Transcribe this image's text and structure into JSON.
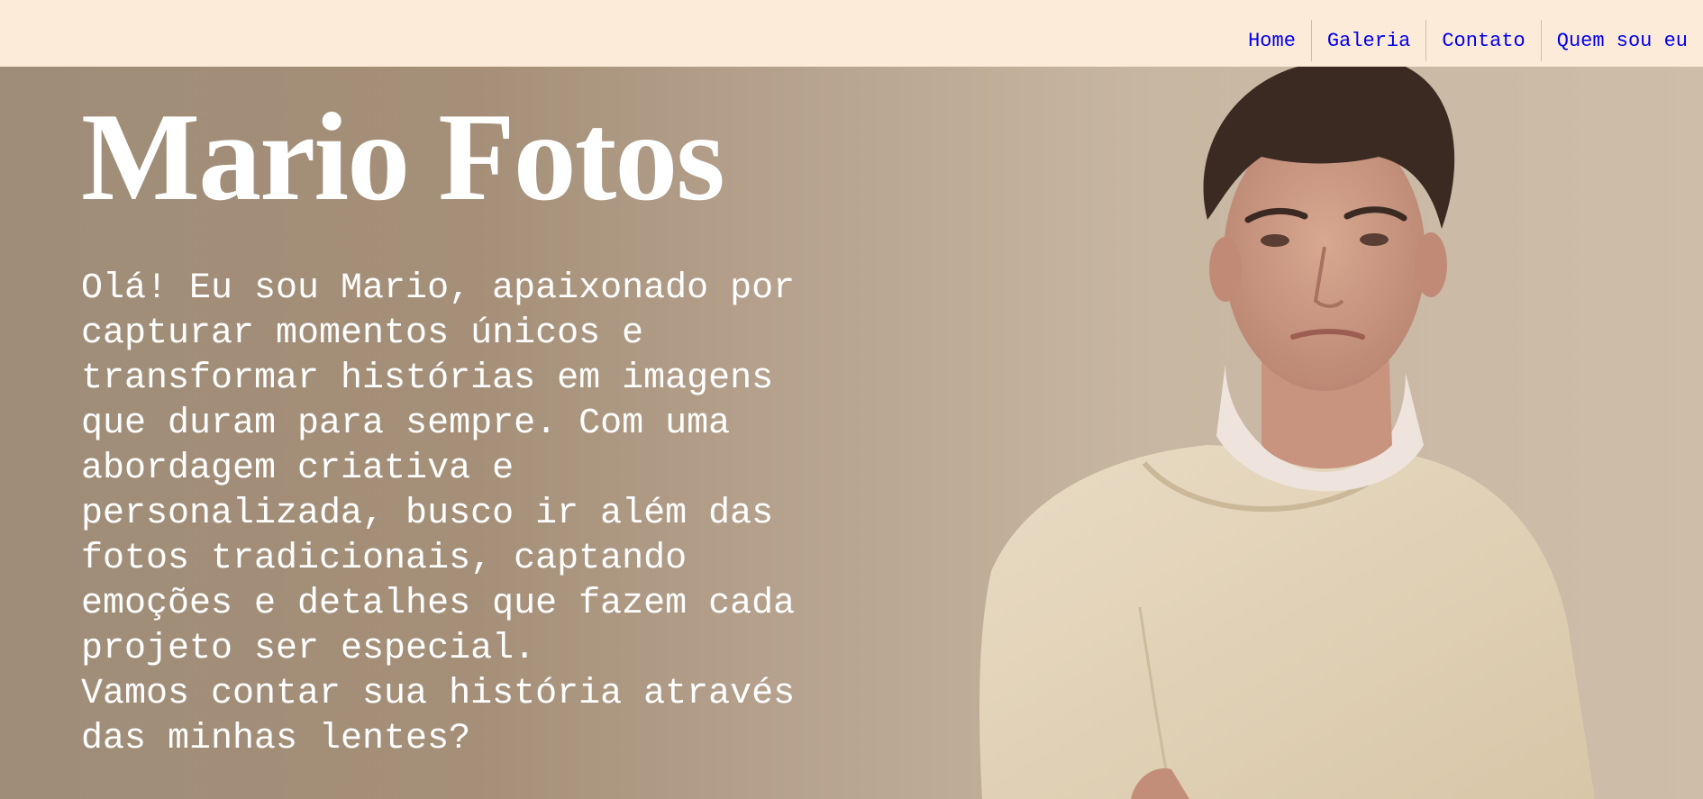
{
  "nav": {
    "items": [
      {
        "label": "Home"
      },
      {
        "label": "Galeria"
      },
      {
        "label": "Contato"
      },
      {
        "label": "Quem sou eu"
      }
    ]
  },
  "hero": {
    "title": "Mario Fotos",
    "paragraph": "Olá! Eu sou Mario, apaixonado por\ncapturar momentos únicos e\ntransformar histórias em imagens\nque duram para sempre. Com uma\nabordagem criativa e\npersonalizada, busco ir além das\nfotos tradicionais, captando\nemoções e detalhes que fazem cada\nprojeto ser especial.\nVamos contar sua história através\ndas minhas lentes?"
  },
  "colors": {
    "topbar": "#fdebd9",
    "nav_link": "#0000ee",
    "hero_text": "#ffffff"
  }
}
